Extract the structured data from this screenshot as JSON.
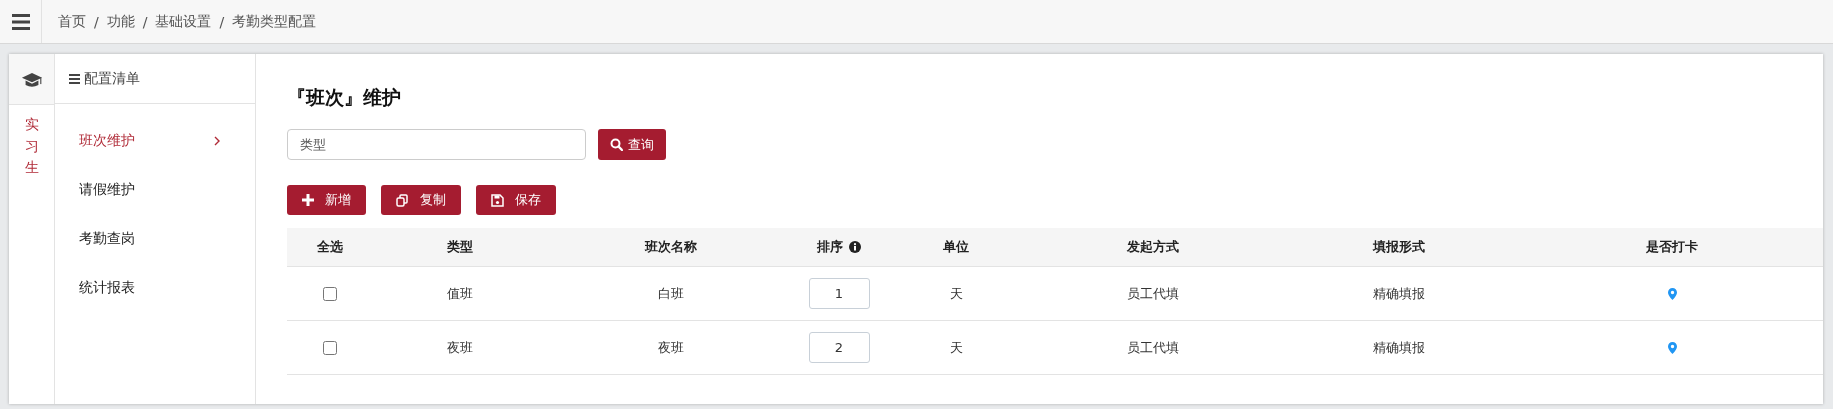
{
  "topbar": {
    "breadcrumb": [
      "首页",
      "功能",
      "基础设置",
      "考勤类型配置"
    ],
    "separator": "/"
  },
  "rail": {
    "label": "实习生"
  },
  "menu": {
    "title": "配置清单",
    "items": [
      {
        "label": "班次维护",
        "selected": true
      },
      {
        "label": "请假维护",
        "selected": false
      },
      {
        "label": "考勤查岗",
        "selected": false
      },
      {
        "label": "统计报表",
        "selected": false
      }
    ]
  },
  "page": {
    "title": "『班次』维护"
  },
  "search": {
    "placeholder": "类型",
    "button": "查询"
  },
  "actions": [
    {
      "label": "新增",
      "kind": "add"
    },
    {
      "label": "复制",
      "kind": "copy"
    },
    {
      "label": "保存",
      "kind": "save"
    }
  ],
  "table": {
    "columns": [
      {
        "label": "全选"
      },
      {
        "label": "类型"
      },
      {
        "label": "班次名称"
      },
      {
        "label": "排序",
        "info": true
      },
      {
        "label": "单位"
      },
      {
        "label": "发起方式"
      },
      {
        "label": "填报形式"
      },
      {
        "label": "是否打卡"
      }
    ],
    "rows": [
      {
        "checked": false,
        "type": "值班",
        "name": "白班",
        "order": "1",
        "unit": "天",
        "initiation": "员工代填",
        "fill_form": "精确填报",
        "clock_in": true
      },
      {
        "checked": false,
        "type": "夜班",
        "name": "夜班",
        "order": "2",
        "unit": "天",
        "initiation": "员工代填",
        "fill_form": "精确填报",
        "clock_in": true
      }
    ]
  }
}
